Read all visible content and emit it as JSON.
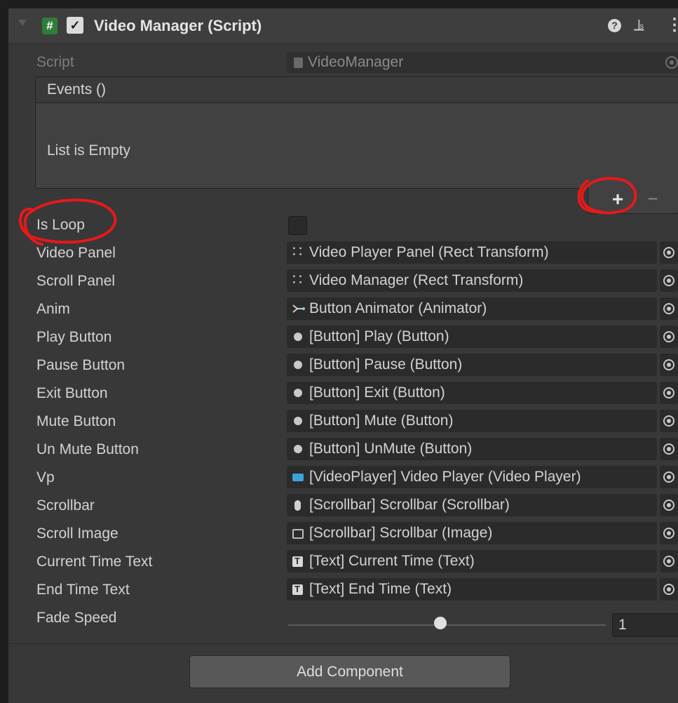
{
  "component": {
    "title": "Video Manager (Script)",
    "enabled": true
  },
  "script_field": {
    "label": "Script",
    "value": "VideoManager"
  },
  "events": {
    "title": "Events ()",
    "empty_text": "List is Empty",
    "add_label": "+",
    "remove_label": "−"
  },
  "properties": [
    {
      "label": "Is Loop",
      "type": "checkbox",
      "checked": false
    },
    {
      "label": "Video Panel",
      "type": "object",
      "icon": "rect-transform-icon",
      "value": "Video Player Panel (Rect Transform)"
    },
    {
      "label": "Scroll Panel",
      "type": "object",
      "icon": "rect-transform-icon",
      "value": "Video Manager (Rect Transform)"
    },
    {
      "label": "Anim",
      "type": "object",
      "icon": "animator-icon",
      "value": "Button Animator (Animator)"
    },
    {
      "label": "Play Button",
      "type": "object",
      "icon": "button-icon",
      "value": "[Button] Play (Button)"
    },
    {
      "label": "Pause Button",
      "type": "object",
      "icon": "button-icon",
      "value": "[Button] Pause (Button)"
    },
    {
      "label": "Exit Button",
      "type": "object",
      "icon": "button-icon",
      "value": "[Button] Exit (Button)"
    },
    {
      "label": "Mute Button",
      "type": "object",
      "icon": "button-icon",
      "value": "[Button] Mute (Button)"
    },
    {
      "label": "Un Mute Button",
      "type": "object",
      "icon": "button-icon",
      "value": "[Button] UnMute (Button)"
    },
    {
      "label": "Vp",
      "type": "object",
      "icon": "video-player-icon",
      "value": "[VideoPlayer] Video Player (Video Player)"
    },
    {
      "label": "Scrollbar",
      "type": "object",
      "icon": "scrollbar-icon",
      "value": "[Scrollbar] Scrollbar (Scrollbar)"
    },
    {
      "label": "Scroll Image",
      "type": "object",
      "icon": "image-icon",
      "value": "[Scrollbar] Scrollbar (Image)"
    },
    {
      "label": "Current Time Text",
      "type": "object",
      "icon": "text-icon",
      "value": "[Text] Current Time (Text)"
    },
    {
      "label": "End Time Text",
      "type": "object",
      "icon": "text-icon",
      "value": "[Text] End Time (Text)"
    }
  ],
  "fade_speed": {
    "label": "Fade Speed",
    "value": "1",
    "slider_fraction": 0.48
  },
  "add_component_label": "Add Component",
  "colors": {
    "annotation": "#e8181b",
    "script_icon": "#2f7d3a",
    "panel_bg": "#383838"
  }
}
